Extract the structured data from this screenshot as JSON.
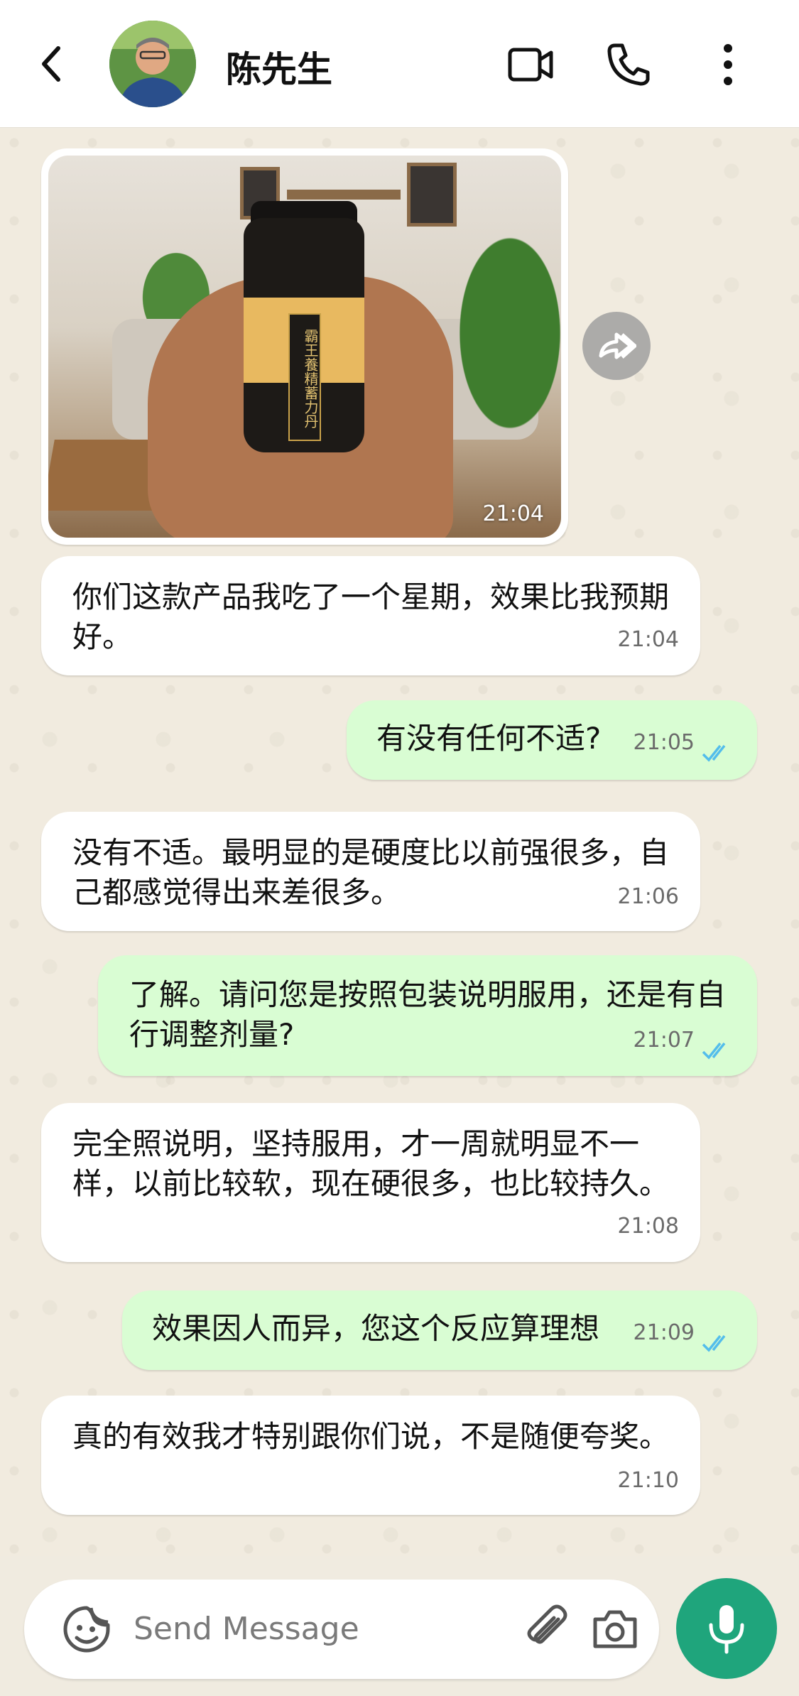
{
  "header": {
    "contact_name": "陈先生"
  },
  "image_message": {
    "time": "21:04",
    "bottle_label": "霸王養精蓄力丹"
  },
  "messages": [
    {
      "dir": "in",
      "text": "你们这款产品我吃了一个星期，效果比我预期好。",
      "time": "21:04"
    },
    {
      "dir": "out",
      "text": "有没有任何不适?",
      "time": "21:05"
    },
    {
      "dir": "in",
      "text": "没有不适。最明显的是硬度比以前强很多，自己都感觉得出来差很多。",
      "time": "21:06"
    },
    {
      "dir": "out",
      "text": "了解。请问您是按照包装说明服用，还是有自行调整剂量?",
      "time": "21:07"
    },
    {
      "dir": "in",
      "text": "完全照说明，坚持服用，才一周就明显不一样，以前比较软，现在硬很多，也比较持久。",
      "time": "21:08"
    },
    {
      "dir": "out",
      "text": "效果因人而异，您这个反应算理想",
      "time": "21:09"
    },
    {
      "dir": "in",
      "text": "真的有效我才特别跟你们说，不是随便夸奖。",
      "time": "21:10"
    }
  ],
  "composer": {
    "placeholder": "Send Message"
  },
  "colors": {
    "incoming_bubble": "#ffffff",
    "outgoing_bubble": "#d9fdd3",
    "chat_background": "#f1ebdf",
    "read_ticks": "#53bdeb",
    "mic_button": "#1fa57c"
  }
}
